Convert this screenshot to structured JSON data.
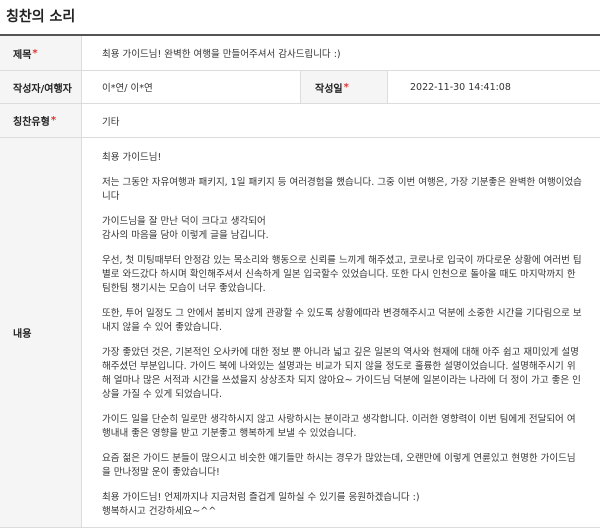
{
  "page": {
    "title": "칭찬의 소리"
  },
  "form": {
    "title_label": "제목",
    "title_value": "최용 가이드님! 완벽한 여행을 만들어주셔서 감사드립니다 :)",
    "author_label": "작성자/여행자",
    "author_value": "이*연/ 이*연",
    "date_label": "작성일",
    "date_value": "2022-11-30 14:41:08",
    "type_label": "칭찬유형",
    "type_value": "기타",
    "content_label": "내용",
    "required_mark": "*",
    "content_paragraphs": [
      "최용 가이드님!",
      "저는 그동안 자유여행과 패키지, 1일 패키지 등 여러경험을 했습니다. 그중 이번 여행은, 가장 기분좋은 완벽한 여행이었습니다",
      "가이드님을 잘 만난 덕이 크다고 생각되어\n감사의 마음을 담아 이렇게 글을 남깁니다.",
      "우선, 첫 미팅때부터 안정감 있는 목소리와 행동으로 신뢰를 느끼게 해주셨고, 코로나로 입국이 까다로운 상황에 여러번 팁별로 와드갔다 하시며 확인해주셔서 신속하게 일본 입국할수 있었습니다. 또한 다시 인천으로 돌아올 때도 마지막까지 한팀한팀 챙기시는 모습이 너무 좋았습니다.",
      "또한, 투어 일정도 그 안에서 붐비지 않게 관광할 수 있도록 상황에따라 변경해주시고 덕분에 소중한 시간을 기다림으로 보내지 않을 수 있어 좋았습니다.",
      "가장 좋았던 것은, 기본적인 오사카에 대한 정보 뿐 아니라 넓고 깊은 일본의 역사와 현재에 대해 아주 쉽고 재미있게 설명해주셨던 부분입니다. 가이드 북에 나와있는 설명과는 비교가 되지 않을 정도로 훌륭한 설명이었습니다. 설명해주시기 위해 얼마나 많은 서적과 시간을 쓰셨을지 상상조차 되지 않아요~ 가이드님 덕분에 일본이라는 나라에 더 정이 가고 좋은 인상을 가질 수 있게 되었습니다.",
      "가이드 일을 단순히 일로만 생각하시지 않고 사랑하시는 분이라고 생각합니다. 이러한 영향력이 이번 팀에게 전달되어 여행내내 좋은 영향을 받고 기분좋고 행복하게 보낼 수 있었습니다.",
      "요즘 젊은 가이드 분들이 많으시고 비슷한 얘기들만 하시는 경우가 많았는데, 오랜만에 이렇게 연륜있고 현명한 가이드님을 만나정말 운이 좋았습니다!",
      "최용 가이드님! 언제까지나 지금처럼 즐겁게 일하실 수 있기를 응원하겠습니다 :)\n행복하시고 건강하세요~^^"
    ]
  }
}
